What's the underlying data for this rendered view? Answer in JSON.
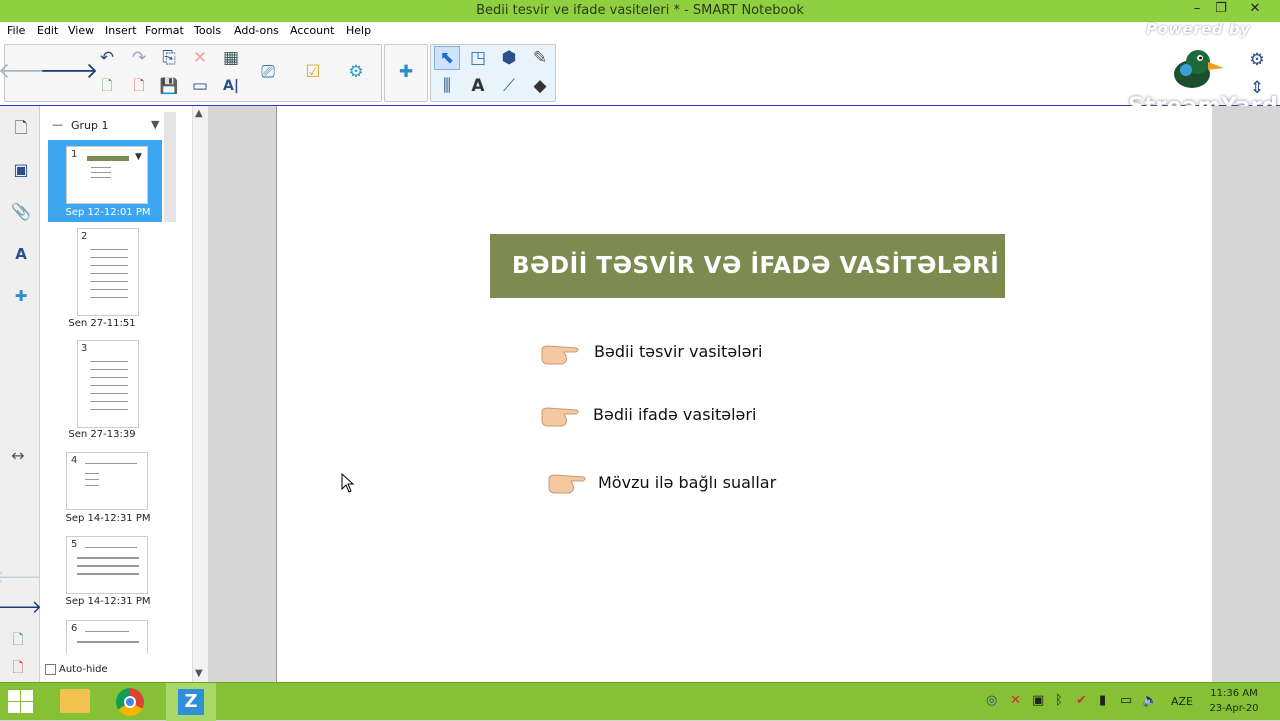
{
  "window": {
    "title": "Bedii tesvir ve ifade vasiteleri * - SMART Notebook",
    "minimize": "–",
    "restore": "❐",
    "close": "✕"
  },
  "menu": [
    "File",
    "Edit",
    "View",
    "Insert",
    "Format",
    "Tools",
    "Add-ons",
    "Account",
    "Help"
  ],
  "watermark": {
    "top": "Powered by",
    "bottom": "StreamYard"
  },
  "sidebar": {
    "group_label": "Grup 1",
    "autohide_label": "Auto-hide",
    "pages": [
      {
        "num": "1",
        "date": "Sep 12-12:01 PM",
        "selected": true
      },
      {
        "num": "2",
        "date": "Sen 27-11:51"
      },
      {
        "num": "3",
        "date": "Sen 27-13:39"
      },
      {
        "num": "4",
        "date": "Sep 14-12:31 PM"
      },
      {
        "num": "5",
        "date": "Sep 14-12:31 PM"
      },
      {
        "num": "6",
        "date": ""
      }
    ]
  },
  "slide": {
    "heading": "BƏDİİ TƏSVİR VƏ İFADƏ VASİTƏLƏRİ",
    "bullets": [
      "Bədii təsvir vasitələri",
      "Bədii ifadə vasitələri",
      "Mövzu ilə bağlı suallar"
    ],
    "heading_color": "#7d8a50"
  },
  "taskbar": {
    "lang": "AZE",
    "time": "11:36 AM",
    "date": "23-Apr-20"
  },
  "colors": {
    "titlebar": "#8fd040",
    "taskbar": "#86c035",
    "selected": "#3ea6f0"
  }
}
